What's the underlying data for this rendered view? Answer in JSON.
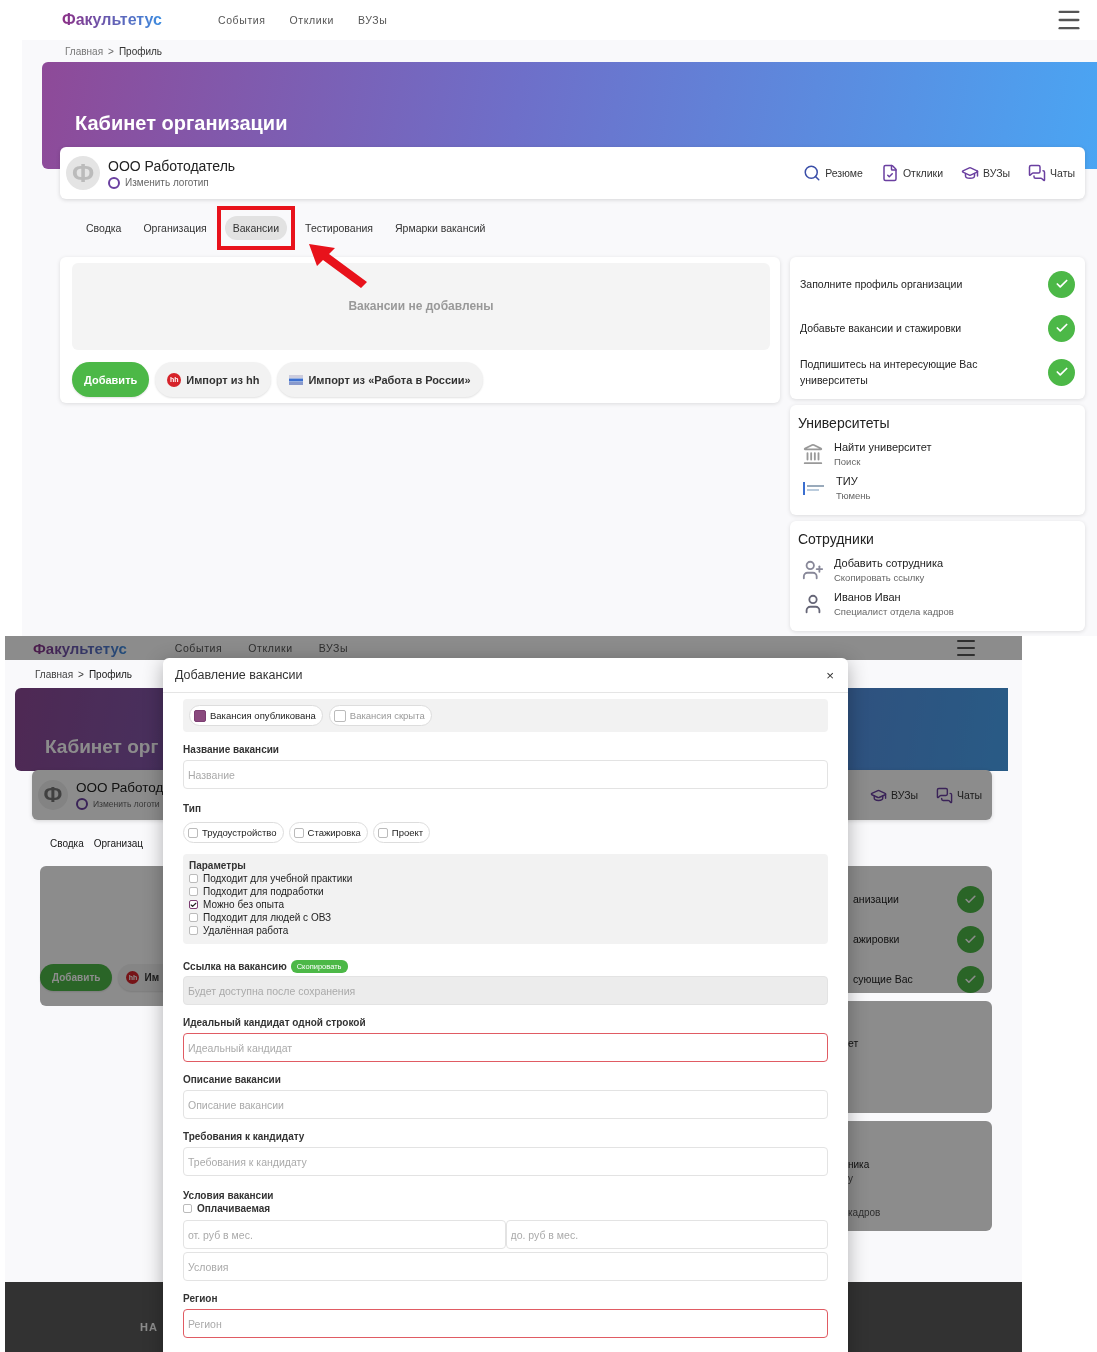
{
  "top_screen": {
    "header": {
      "logo": "Факультетус",
      "nav": [
        "События",
        "Отклики",
        "ВУЗы"
      ]
    },
    "breadcrumb": {
      "items": [
        "Главная",
        "Профиль"
      ],
      "separator": ">"
    },
    "banner_title": "Кабинет организации",
    "org": {
      "logo_letter": "Ф",
      "name": "ООО Работодатель",
      "change_logo": "Изменить логотип"
    },
    "quick_links": [
      {
        "kind": "search",
        "label": "Резюме"
      },
      {
        "kind": "responses",
        "label": "Отклики"
      },
      {
        "kind": "universities",
        "label": "ВУЗы"
      },
      {
        "kind": "chats",
        "label": "Чаты"
      }
    ],
    "tabs": [
      {
        "label": "Сводка",
        "selected": false,
        "highlighted": false
      },
      {
        "label": "Организация",
        "selected": false,
        "highlighted": false
      },
      {
        "label": "Вакансии",
        "selected": true,
        "highlighted": true
      },
      {
        "label": "Тестирования",
        "selected": false,
        "highlighted": false
      },
      {
        "label": "Ярмарки вакансий",
        "selected": false,
        "highlighted": false
      }
    ],
    "vacancies": {
      "empty_text": "Вакансии не добавлены",
      "buttons": [
        {
          "kind": "primary",
          "label": "Добавить"
        },
        {
          "kind": "hh",
          "label": "Импорт из hh",
          "icon_text": "hh"
        },
        {
          "kind": "trudvsem",
          "label": "Импорт из «Работа в России»"
        }
      ]
    },
    "checklist": [
      {
        "text": "Заполните профиль организации",
        "done": true
      },
      {
        "text": "Добавьте вакансии и стажировки",
        "done": true
      },
      {
        "text": "Подпишитесь на интересующие Вас университеты",
        "done": true
      }
    ],
    "universities": {
      "title": "Университеты",
      "items": [
        {
          "kind": "search",
          "name": "Найти университет",
          "subtitle": "Поиск"
        },
        {
          "kind": "university",
          "name": "ТИУ",
          "subtitle": "Тюмень"
        }
      ]
    },
    "staff": {
      "title": "Сотрудники",
      "items": [
        {
          "kind": "add",
          "name": "Добавить сотрудника",
          "subtitle": "Скопировать ссылку"
        },
        {
          "kind": "person",
          "name": "Иванов Иван",
          "subtitle": "Специалист отдела кадров"
        }
      ]
    }
  },
  "bottom_screen": {
    "header": {
      "logo": "Факультетус",
      "nav": [
        "События",
        "Отклики",
        "ВУЗы"
      ]
    },
    "breadcrumb": {
      "items": [
        "Главная",
        "Профиль"
      ],
      "separator": ">"
    },
    "banner_title": "Кабинет орг",
    "org": {
      "logo_letter": "Ф",
      "name": "ООО Работод",
      "change_logo": "Изменить логоти"
    },
    "quick_links": [
      {
        "kind": "universities",
        "label": "ВУЗы"
      },
      {
        "kind": "chats",
        "label": "Чаты"
      }
    ],
    "tabs": [
      "Сводка",
      "Организац"
    ],
    "add_button": "Добавить",
    "import_button": {
      "icon_text": "hh",
      "label": "Им"
    },
    "checklist": [
      {
        "text": "анизации",
        "done": true
      },
      {
        "text": "ажировки",
        "done": true
      },
      {
        "text": "сующие Вас",
        "done": true
      }
    ],
    "universities_fragment": "ет",
    "staff_fragments": [
      "ника",
      "у",
      "кадров"
    ],
    "footer_fragment": "НА",
    "modal": {
      "title": "Добавление вакансии",
      "close": "×",
      "visibility": [
        {
          "label": "Вакансия опубликована",
          "selected": true
        },
        {
          "label": "Вакансия скрыта",
          "selected": false
        }
      ],
      "sections": [
        {
          "kind": "input",
          "label": "Название вакансии",
          "placeholder": "Название",
          "error": false
        },
        {
          "kind": "chips",
          "label": "Тип",
          "options": [
            {
              "label": "Трудоустройство",
              "checked": false
            },
            {
              "label": "Стажировка",
              "checked": false
            },
            {
              "label": "Проект",
              "checked": false
            }
          ]
        },
        {
          "kind": "params",
          "label": "Параметры",
          "options": [
            {
              "label": "Подходит для учебной практики",
              "checked": false
            },
            {
              "label": "Подходит для подработки",
              "checked": false
            },
            {
              "label": "Можно без опыта",
              "checked": true
            },
            {
              "label": "Подходит для людей с ОВЗ",
              "checked": false
            },
            {
              "label": "Удалённая работа",
              "checked": false
            }
          ]
        },
        {
          "kind": "link",
          "label": "Ссылка на вакансию",
          "action": "Скопировать",
          "placeholder": "Будет доступна после сохранения",
          "disabled": true
        },
        {
          "kind": "input",
          "label": "Идеальный кандидат одной строкой",
          "placeholder": "Идеальный кандидат",
          "error": true
        },
        {
          "kind": "input",
          "label": "Описание вакансии",
          "placeholder": "Описание вакансии",
          "error": false
        },
        {
          "kind": "input",
          "label": "Требования к кандидату",
          "placeholder": "Требования к кандидату",
          "error": false
        },
        {
          "kind": "conditions",
          "label": "Условия вакансии",
          "paid": {
            "label": "Оплачиваемая",
            "checked": false
          },
          "salary": [
            {
              "placeholder": "от. руб в мес."
            },
            {
              "placeholder": "до. руб в мес."
            }
          ],
          "placeholder": "Условия"
        },
        {
          "kind": "input",
          "label": "Регион",
          "placeholder": "Регион",
          "error": true
        }
      ]
    }
  }
}
